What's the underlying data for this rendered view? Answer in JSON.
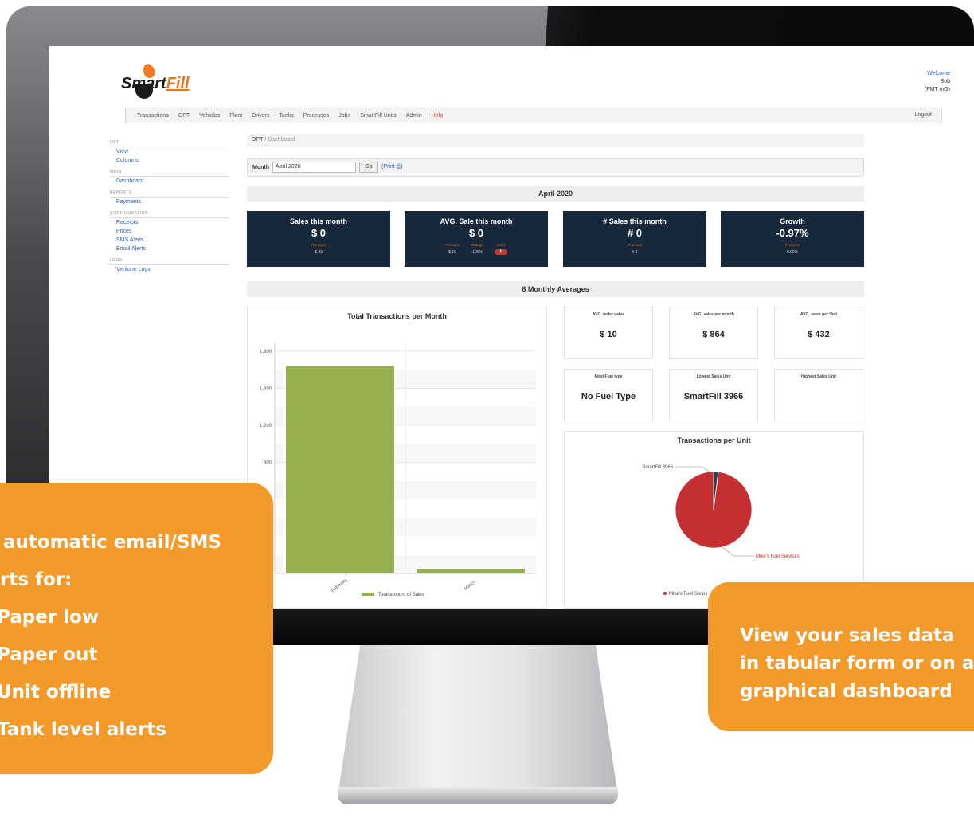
{
  "app": {
    "logo": {
      "smart": "Smart",
      "fill": "Fill"
    },
    "welcome": {
      "greeting": "Welcome",
      "user": "Bob",
      "org": "(FMT mG)"
    },
    "nav": {
      "items": [
        "Transactions",
        "OPT",
        "Vehicles",
        "Plant",
        "Drivers",
        "Tanks",
        "Processes",
        "Jobs",
        "SmartFill Units",
        "Admin",
        "Help"
      ],
      "logout": "Logout"
    },
    "sidebar": {
      "sections": [
        {
          "title": "OPT",
          "items": [
            "View",
            "Columns"
          ]
        },
        {
          "title": "MAIN",
          "items": [
            "Dashboard"
          ]
        },
        {
          "title": "REPORTS",
          "items": [
            "Payments"
          ]
        },
        {
          "title": "CONFIGURATION",
          "items": [
            "Receipts",
            "Prices",
            "SMS Alerts",
            "Email Alerts"
          ]
        },
        {
          "title": "LOGS",
          "items": [
            "Verifone Logs"
          ]
        }
      ]
    },
    "breadcrumb": {
      "root": "OPT",
      "sep": "/",
      "current": "Dashboard"
    },
    "month_filter": {
      "label": "Month",
      "value": "April 2020",
      "go": "Go",
      "print": "(Print",
      "print_icon": "print-icon",
      "print_close": ")"
    },
    "month_header": "April 2020",
    "kpis": [
      {
        "title": "Sales this month",
        "value": "$ 0",
        "sub": [
          {
            "label": "Previous",
            "value": "$ 49"
          }
        ]
      },
      {
        "title": "AVG. Sale this month",
        "value": "$ 0",
        "sub": [
          {
            "label": "Previous",
            "value": "$ 16"
          },
          {
            "label": "Change",
            "value": "-100%"
          },
          {
            "label": "trend",
            "value": ""
          }
        ]
      },
      {
        "title": "# Sales this month",
        "value": "# 0",
        "sub": [
          {
            "label": "Previous",
            "value": "# 3"
          }
        ]
      },
      {
        "title": "Growth",
        "value": "-0.97%",
        "sub": [
          {
            "label": "Previous",
            "value": "0.00%"
          }
        ]
      }
    ],
    "averages_header": "6 Monthly Averages",
    "stats": [
      {
        "label": "AVG. order value",
        "value": "$ 10"
      },
      {
        "label": "AVG. sales per month",
        "value": "$ 864"
      },
      {
        "label": "AVG. sales per Unit",
        "value": "$ 432"
      },
      {
        "label": "Most Fuel type",
        "value": "No Fuel Type"
      },
      {
        "label": "Lowest Sales Unit",
        "value": "SmartFill 3966"
      },
      {
        "label": "Highest Sales Unit",
        "value": ""
      }
    ],
    "kpi_colors": {
      "bg": "#17283b",
      "accent": "#e8791f",
      "trend": "#c0392b"
    }
  },
  "chart_data": [
    {
      "type": "bar",
      "title": "Total Transactions per Month",
      "categories": [
        "February",
        "March"
      ],
      "series": [
        {
          "name": "Total amount of Sales",
          "values": [
            1680,
            35
          ],
          "color": "#96b050"
        }
      ],
      "yticks": [
        "1,800",
        "1,500",
        "1,200",
        "900"
      ],
      "ylim": [
        0,
        1800
      ],
      "grid": true,
      "legend": "bottom"
    },
    {
      "type": "pie",
      "title": "Transactions per Unit",
      "slices": [
        {
          "name": "SmartFill 3966",
          "value": 2,
          "color": "#2c3e50"
        },
        {
          "name": "Mike's Fuel Services",
          "value": 98,
          "color": "#c62f2f"
        }
      ],
      "legend_partial": "Mike's Fuel Servic",
      "legend": "bottom"
    }
  ],
  "callouts": {
    "left": [
      "automatic email/SMS",
      "rts for:",
      "Paper low",
      "Paper out",
      "Unit offline",
      "Tank level alerts"
    ],
    "right": [
      "View your sales data",
      "in tabular form or on a",
      "graphical dashboard"
    ],
    "color": "#f39a2b"
  }
}
